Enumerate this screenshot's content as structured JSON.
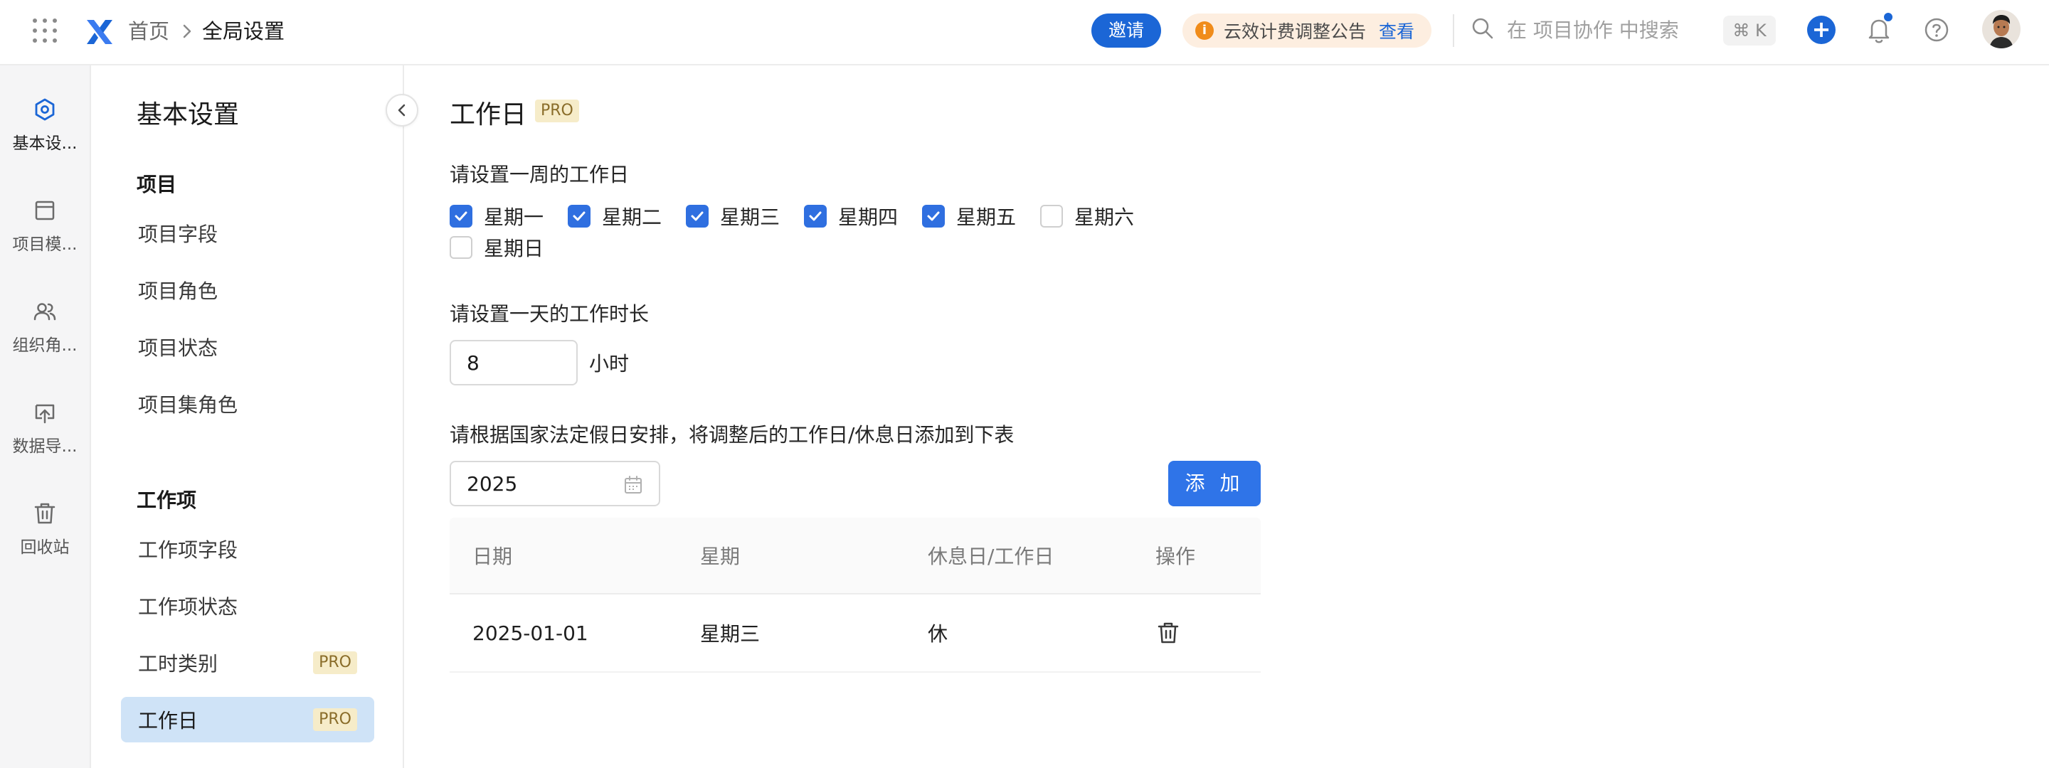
{
  "topbar": {
    "breadcrumb_home": "首页",
    "breadcrumb_current": "全局设置",
    "invite_label": "邀请",
    "notice_icon": "i",
    "notice_text": "云效计费调整公告",
    "notice_link": "查看",
    "search_placeholder": "在 项目协作 中搜索",
    "shortcut": "⌘ K",
    "add_icon": "+",
    "accent_color": "#1b66d6"
  },
  "rail": {
    "items": [
      {
        "label": "基本设...",
        "icon": "settings-hexagon-icon",
        "active": true
      },
      {
        "label": "项目模...",
        "icon": "template-icon"
      },
      {
        "label": "组织角...",
        "icon": "users-icon"
      },
      {
        "label": "数据导...",
        "icon": "import-icon"
      },
      {
        "label": "回收站",
        "icon": "trash-icon"
      }
    ]
  },
  "subnav": {
    "title": "基本设置",
    "groups": [
      {
        "label": "项目",
        "items": [
          "项目字段",
          "项目角色",
          "项目状态",
          "项目集角色"
        ]
      },
      {
        "label": "工作项",
        "items": [
          "工作项字段",
          "工作项状态",
          "工时类别",
          "工作日"
        ]
      }
    ],
    "pro_tag": "PRO",
    "active_item": "工作日"
  },
  "main": {
    "title": "工作日",
    "pro_tag": "PRO",
    "week_label": "请设置一周的工作日",
    "days": [
      {
        "label": "星期一",
        "checked": true
      },
      {
        "label": "星期二",
        "checked": true
      },
      {
        "label": "星期三",
        "checked": true
      },
      {
        "label": "星期四",
        "checked": true
      },
      {
        "label": "星期五",
        "checked": true
      },
      {
        "label": "星期六",
        "checked": false
      },
      {
        "label": "星期日",
        "checked": false
      }
    ],
    "hours_label": "请设置一天的工作时长",
    "hours_value": "8",
    "hours_unit": "小时",
    "holiday_label": "请根据国家法定假日安排，将调整后的工作日/休息日添加到下表",
    "year_value": "2025",
    "add_label": "添 加",
    "table": {
      "headers": [
        "日期",
        "星期",
        "休息日/工作日",
        "操作"
      ],
      "rows": [
        {
          "date": "2025-01-01",
          "weekday": "星期三",
          "type": "休",
          "action_icon": "trash-icon"
        }
      ]
    }
  }
}
